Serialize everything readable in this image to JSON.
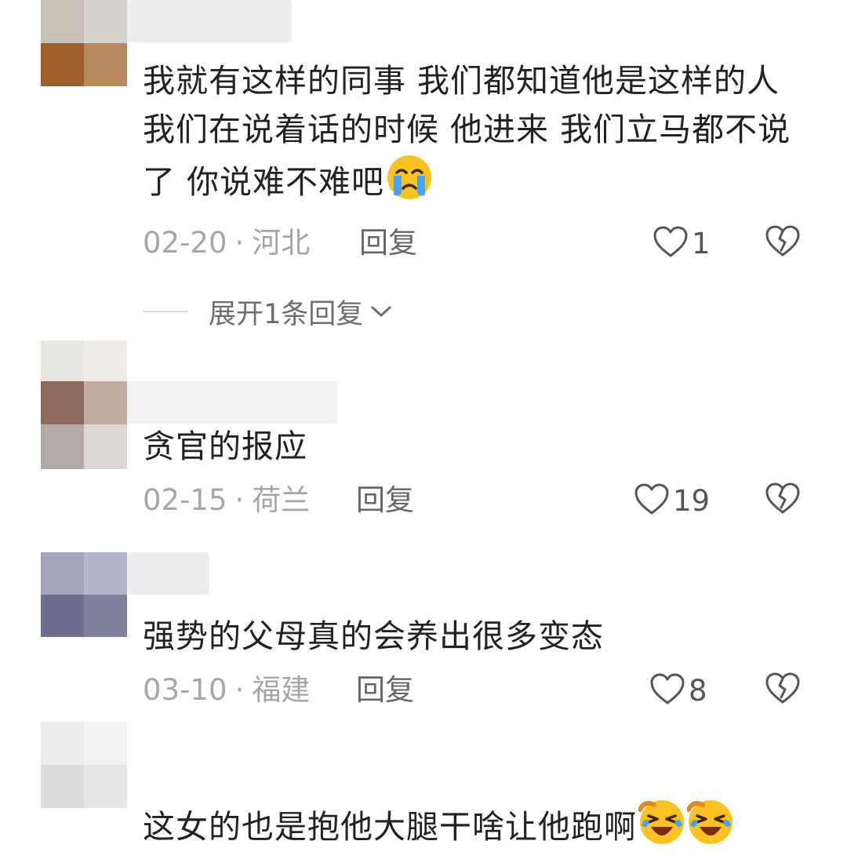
{
  "comments": [
    {
      "text": "我就有这样的同事 我们都知道他是这样的人 我们在说着话的时候 他进来 我们立马都不说了 你说难不难吧",
      "emoji": "crying-face",
      "date": "02-20",
      "location": "河北",
      "reply_label": "回复",
      "likes": "1"
    },
    {
      "text": "贪官的报应",
      "date": "02-15",
      "location": "荷兰",
      "reply_label": "回复",
      "likes": "19"
    },
    {
      "text": "强势的父母真的会养出很多变态",
      "date": "03-10",
      "location": "福建",
      "reply_label": "回复",
      "likes": "8"
    },
    {
      "text": "这女的也是抱他大腿干啥让他跑啊",
      "emoji": "laughing-crying-face"
    }
  ],
  "expand_replies": {
    "label": "展开1条回复"
  },
  "icons": {
    "like": "heart-outline-icon",
    "dislike": "broken-heart-icon",
    "expand": "chevron-down-icon"
  },
  "colors": {
    "text": "#222222",
    "meta": "#a6a6a6",
    "icon": "#555555",
    "emoji_yellow": "#f9c221",
    "emoji_tear": "#4aa3f0"
  }
}
